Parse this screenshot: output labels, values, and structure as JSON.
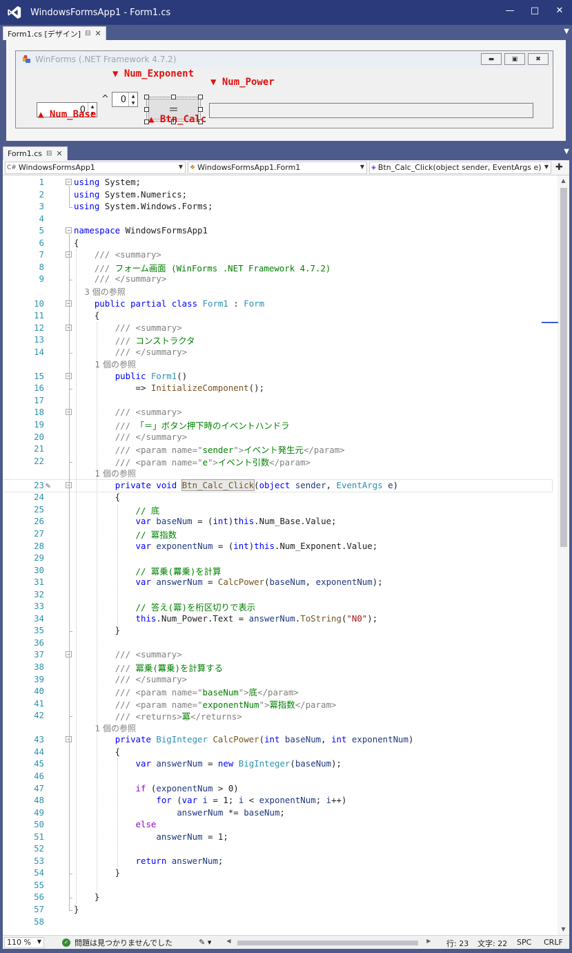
{
  "window": {
    "title": "WindowsFormsApp1 - Form1.cs",
    "accent": "#2b3a7a"
  },
  "designer_tab": {
    "label": "Form1.cs [デザイン]"
  },
  "form": {
    "title": "WinForms (.NET Framework 4.7.2)",
    "num_base_value": "0",
    "caret": "^",
    "num_exponent_value": "0",
    "calc_label": "＝",
    "power_value": ""
  },
  "annotations": {
    "num_exponent": "▼ Num_Exponent",
    "num_power": "▼ Num_Power",
    "num_base": "▲ Num_Base",
    "btn_calc": "▲ Btn_Calc"
  },
  "code_tab": {
    "label": "Form1.cs"
  },
  "navbar": {
    "project": "WindowsFormsApp1",
    "class": "WindowsFormsApp1.Form1",
    "member": "Btn_Calc_Click(object sender, EventArgs e)"
  },
  "code_lines": [
    {
      "n": "1",
      "t": "using System;"
    },
    {
      "n": "2",
      "t": "using System.Numerics;"
    },
    {
      "n": "3",
      "t": "using System.Windows.Forms;"
    },
    {
      "n": "4",
      "t": ""
    },
    {
      "n": "5",
      "t": "namespace WindowsFormsApp1"
    },
    {
      "n": "6",
      "t": "{"
    },
    {
      "n": "7",
      "t": "    /// <summary>"
    },
    {
      "n": "8",
      "t": "    /// フォーム画面 (WinForms .NET Framework 4.7.2)"
    },
    {
      "n": "9",
      "t": "    /// </summary>"
    },
    {
      "n": "",
      "t": "    3 個の参照"
    },
    {
      "n": "10",
      "t": "    public partial class Form1 : Form"
    },
    {
      "n": "11",
      "t": "    {"
    },
    {
      "n": "12",
      "t": "        /// <summary>"
    },
    {
      "n": "13",
      "t": "        /// コンストラクタ"
    },
    {
      "n": "14",
      "t": "        /// </summary>"
    },
    {
      "n": "",
      "t": "        1 個の参照"
    },
    {
      "n": "15",
      "t": "        public Form1()"
    },
    {
      "n": "16",
      "t": "            => InitializeComponent();"
    },
    {
      "n": "17",
      "t": ""
    },
    {
      "n": "18",
      "t": "        /// <summary>"
    },
    {
      "n": "19",
      "t": "        /// 「＝」ボタン押下時のイベントハンドラ"
    },
    {
      "n": "20",
      "t": "        /// </summary>"
    },
    {
      "n": "21",
      "t": "        /// <param name=\"sender\">イベント発生元</param>"
    },
    {
      "n": "22",
      "t": "        /// <param name=\"e\">イベント引数</param>"
    },
    {
      "n": "",
      "t": "        1 個の参照"
    },
    {
      "n": "23",
      "t": "        private void Btn_Calc_Click(object sender, EventArgs e)"
    },
    {
      "n": "24",
      "t": "        {"
    },
    {
      "n": "25",
      "t": "            // 底"
    },
    {
      "n": "26",
      "t": "            var baseNum = (int)this.Num_Base.Value;"
    },
    {
      "n": "27",
      "t": "            // 冪指数"
    },
    {
      "n": "28",
      "t": "            var exponentNum = (int)this.Num_Exponent.Value;"
    },
    {
      "n": "29",
      "t": ""
    },
    {
      "n": "30",
      "t": "            // 冪乗(羃乗)を計算"
    },
    {
      "n": "31",
      "t": "            var answerNum = CalcPower(baseNum, exponentNum);"
    },
    {
      "n": "32",
      "t": ""
    },
    {
      "n": "33",
      "t": "            // 答え(冪)を桁区切りで表示"
    },
    {
      "n": "34",
      "t": "            this.Num_Power.Text = answerNum.ToString(\"N0\");"
    },
    {
      "n": "35",
      "t": "        }"
    },
    {
      "n": "36",
      "t": ""
    },
    {
      "n": "37",
      "t": "        /// <summary>"
    },
    {
      "n": "38",
      "t": "        /// 冪乗(羃乗)を計算する"
    },
    {
      "n": "39",
      "t": "        /// </summary>"
    },
    {
      "n": "40",
      "t": "        /// <param name=\"baseNum\">底</param>"
    },
    {
      "n": "41",
      "t": "        /// <param name=\"exponentNum\">冪指数</param>"
    },
    {
      "n": "42",
      "t": "        /// <returns>冪</returns>"
    },
    {
      "n": "",
      "t": "        1 個の参照"
    },
    {
      "n": "43",
      "t": "        private BigInteger CalcPower(int baseNum, int exponentNum)"
    },
    {
      "n": "44",
      "t": "        {"
    },
    {
      "n": "45",
      "t": "            var answerNum = new BigInteger(baseNum);"
    },
    {
      "n": "46",
      "t": ""
    },
    {
      "n": "47",
      "t": "            if (exponentNum > 0)"
    },
    {
      "n": "48",
      "t": "                for (var i = 1; i < exponentNum; i++)"
    },
    {
      "n": "49",
      "t": "                    answerNum *= baseNum;"
    },
    {
      "n": "50",
      "t": "            else"
    },
    {
      "n": "51",
      "t": "                answerNum = 1;"
    },
    {
      "n": "52",
      "t": ""
    },
    {
      "n": "53",
      "t": "            return answerNum;"
    },
    {
      "n": "54",
      "t": "        }"
    },
    {
      "n": "55",
      "t": ""
    },
    {
      "n": "56",
      "t": "    }"
    },
    {
      "n": "57",
      "t": "}"
    },
    {
      "n": "58",
      "t": ""
    }
  ],
  "status": {
    "zoom": "110 %",
    "issues": "問題は見つかりませんでした",
    "line": "行: 23",
    "col": "文字: 22",
    "spc": "SPC",
    "crlf": "CRLF"
  },
  "icons": [
    "vs-logo-icon",
    "minimize-icon",
    "maximize-icon",
    "close-icon",
    "pin-icon",
    "csharp-icon",
    "class-icon",
    "method-icon",
    "split-icon",
    "brush-icon",
    "ok-check-icon"
  ]
}
